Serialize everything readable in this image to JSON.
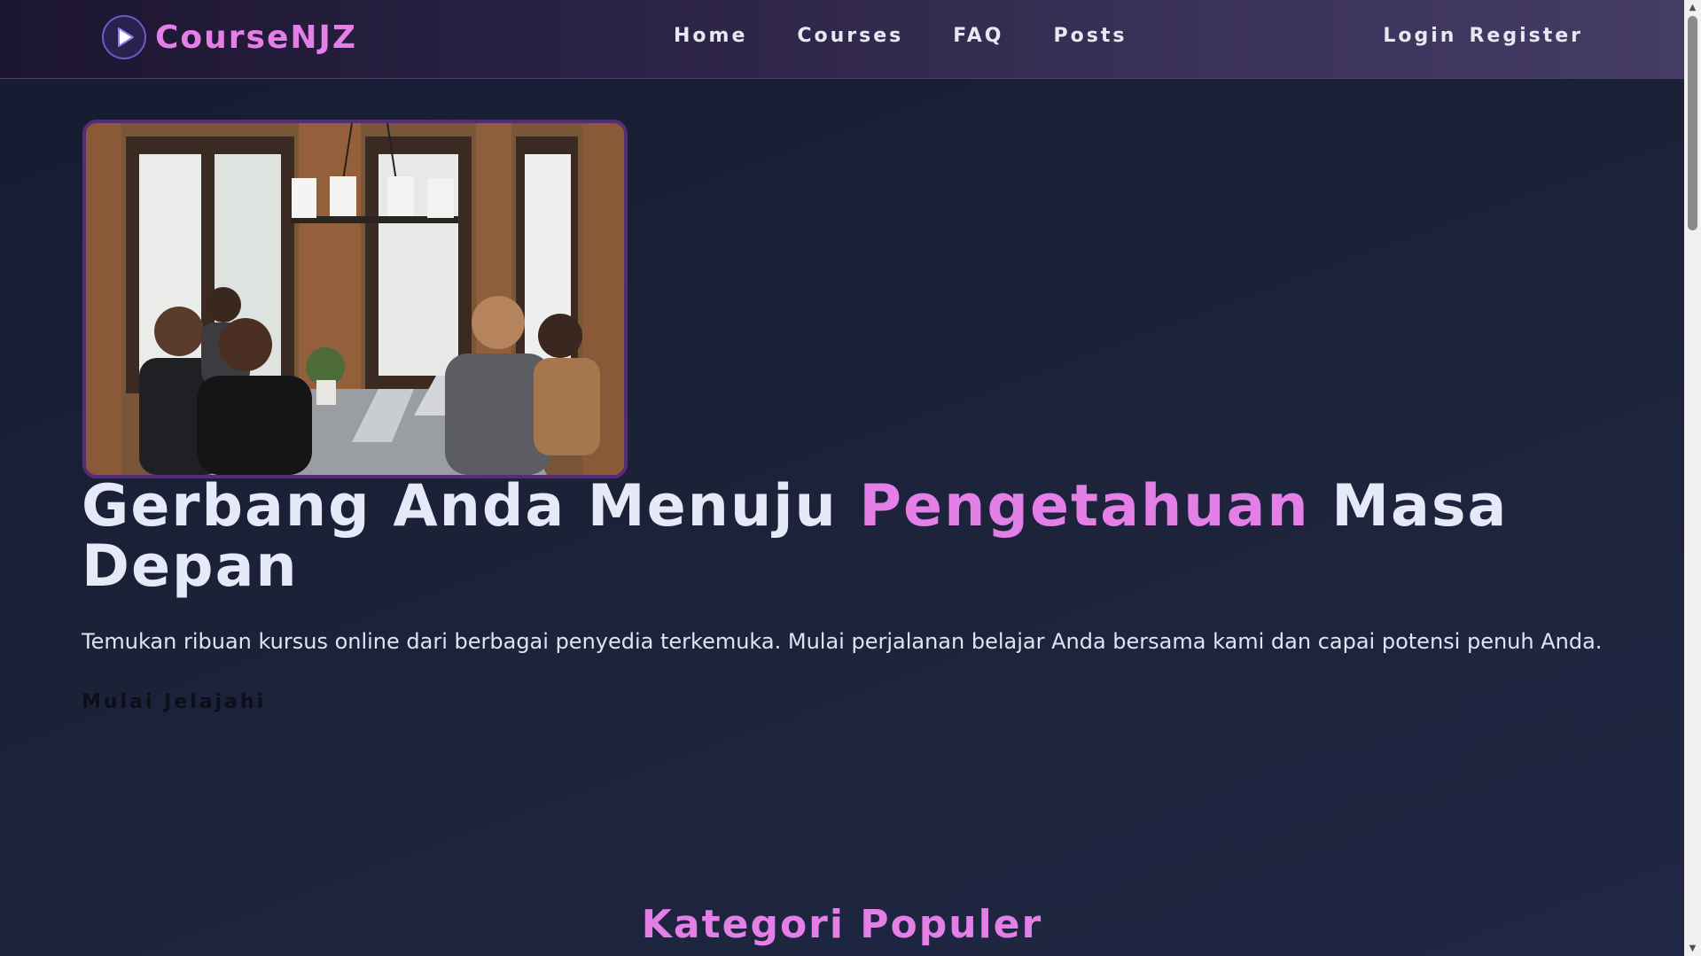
{
  "brand": {
    "name": "CourseNJZ",
    "logo_icon": "play-icon"
  },
  "nav": {
    "items": [
      {
        "label": "Home"
      },
      {
        "label": "Courses"
      },
      {
        "label": "FAQ"
      },
      {
        "label": "Posts"
      }
    ]
  },
  "auth": {
    "login_label": "Login",
    "register_label": "Register"
  },
  "hero": {
    "image_alt_icon": "team-working-photo",
    "title_part1": "Gerbang Anda Menuju ",
    "title_accent": "Pengetahuan",
    "title_part2": " Masa Depan",
    "description": "Temukan ribuan kursus online dari berbagai penyedia terkemuka. Mulai perjalanan belajar Anda bersama kami dan capai potensi penuh Anda.",
    "cta_label": "Mulai Jelajahi"
  },
  "categories": {
    "title": "Kategori Populer"
  },
  "colors": {
    "accent": "#e47fe8",
    "background": "#1a2138",
    "navbar": "#3a3158",
    "text": "#e6eaf8"
  }
}
